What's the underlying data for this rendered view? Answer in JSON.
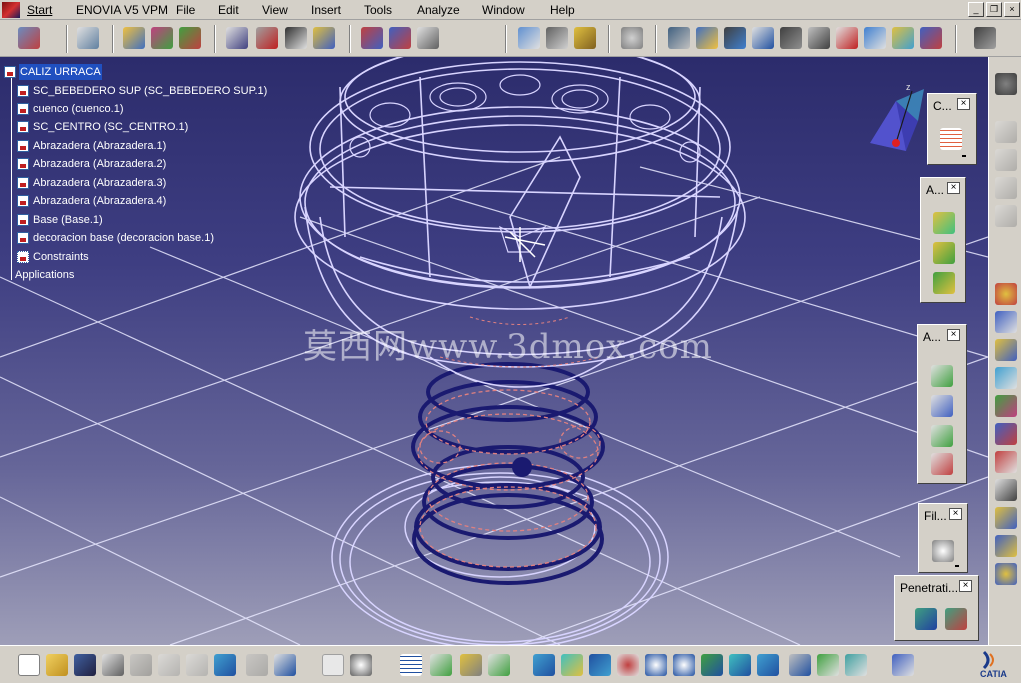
{
  "window": {
    "menu": {
      "start": "Start",
      "enovia": "ENOVIA V5 VPM",
      "file": "File",
      "edit": "Edit",
      "view": "View",
      "insert": "Insert",
      "tools": "Tools",
      "analyze": "Analyze",
      "window": "Window",
      "help": "Help"
    },
    "controls": {
      "minimize": "_",
      "restore": "❐",
      "close": "×"
    }
  },
  "spec_tree": {
    "items": [
      {
        "label": "CALIZ URRACA",
        "selected": true
      },
      {
        "label": "SC_BEBEDERO SUP (SC_BEBEDERO SUP.1)"
      },
      {
        "label": "cuenco (cuenco.1)"
      },
      {
        "label": "SC_CENTRO (SC_CENTRO.1)"
      },
      {
        "label": "Abrazadera (Abrazadera.1)"
      },
      {
        "label": "Abrazadera (Abrazadera.2)"
      },
      {
        "label": "Abrazadera (Abrazadera.3)"
      },
      {
        "label": "Abrazadera (Abrazadera.4)"
      },
      {
        "label": "Base (Base.1)"
      },
      {
        "label": "decoracion base (decoracion base.1)"
      },
      {
        "label": "Constraints"
      },
      {
        "label": "Applications"
      }
    ]
  },
  "watermark": "莫西网www.3dmox.com",
  "compass": {
    "axis_label": "z"
  },
  "floating_toolbars": {
    "constraints": {
      "title": "C..."
    },
    "assembly1": {
      "title": "A..."
    },
    "assembly2": {
      "title": "A..."
    },
    "filter": {
      "title": "Fil..."
    },
    "penetration": {
      "title": "Penetrati..."
    }
  },
  "brand": {
    "logo_text": "CATIA"
  },
  "colors": {
    "ui_gray": "#d4d0c8",
    "viewport_top": "#2c2c6c",
    "viewport_bottom": "#9e9eb8",
    "wireframe_light": "#d8d4ff",
    "wireframe_dark": "#1a1a70",
    "wireframe_accent": "#e08080",
    "selection": "#2050c0"
  }
}
